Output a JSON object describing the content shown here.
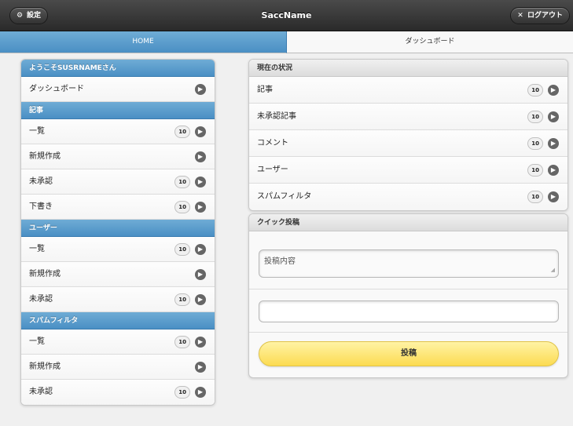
{
  "header": {
    "title": "SaccName",
    "settings_label": "設定",
    "logout_label": "ログアウト"
  },
  "navbar": {
    "tabs": [
      {
        "label": "HOME",
        "active": true
      },
      {
        "label": "ダッシュボード",
        "active": false
      }
    ]
  },
  "sidebar": {
    "welcome": "ようこそSUSRNAMEさん",
    "dashboard_label": "ダッシュボード",
    "sections": [
      {
        "title": "記事",
        "items": [
          {
            "label": "一覧",
            "count": "10"
          },
          {
            "label": "新規作成",
            "count": ""
          },
          {
            "label": "未承認",
            "count": "10"
          },
          {
            "label": "下書き",
            "count": "10"
          }
        ]
      },
      {
        "title": "ユーザー",
        "items": [
          {
            "label": "一覧",
            "count": "10"
          },
          {
            "label": "新規作成",
            "count": ""
          },
          {
            "label": "未承認",
            "count": "10"
          }
        ]
      },
      {
        "title": "スパムフィルタ",
        "items": [
          {
            "label": "一覧",
            "count": "10"
          },
          {
            "label": "新規作成",
            "count": ""
          },
          {
            "label": "未承認",
            "count": "10"
          }
        ]
      }
    ]
  },
  "status": {
    "title": "現在の状況",
    "items": [
      {
        "label": "記事",
        "count": "10"
      },
      {
        "label": "未承認記事",
        "count": "10"
      },
      {
        "label": "コメント",
        "count": "10"
      },
      {
        "label": "ユーザー",
        "count": "10"
      },
      {
        "label": "スパムフィルタ",
        "count": "10"
      }
    ]
  },
  "quickpost": {
    "title": "クイック投稿",
    "textarea_placeholder": "投稿内容",
    "input_value": "",
    "submit_label": "投稿"
  },
  "icons": {
    "settings": "gear-icon",
    "logout": "close-icon",
    "arrow": "chevron-right-icon"
  },
  "colors": {
    "header": "#333333",
    "accent_blue": "#5a9cd0",
    "submit_yellow": "#fcdb51"
  }
}
